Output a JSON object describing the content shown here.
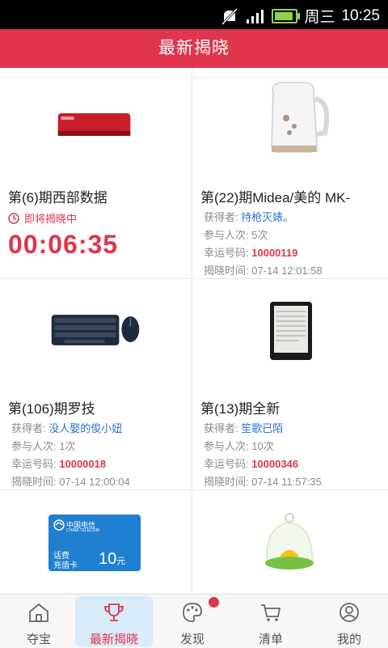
{
  "status_bar": {
    "day": "周三",
    "time": "10:25"
  },
  "header": {
    "title": "最新揭晓"
  },
  "items": [
    {
      "title": "第(6)期西部数据",
      "pending_label": "即将揭晓中",
      "countdown": "00:06:35"
    },
    {
      "title": "第(22)期Midea/美的 MK-",
      "winner_label": "获得者:",
      "winner": "持枪灭婊。",
      "participants_label": "参与人次:",
      "participants": "5次",
      "lucky_label": "幸运号码:",
      "lucky": "10000119",
      "time_label": "揭晓时间:",
      "time": "07-14 12:01:58"
    },
    {
      "title": "第(106)期罗技",
      "winner_label": "获得者:",
      "winner": "没人娶的俊小妞",
      "participants_label": "参与人次:",
      "participants": "1次",
      "lucky_label": "幸运号码:",
      "lucky": "10000018",
      "time_label": "揭晓时间:",
      "time": "07-14 12:00:04"
    },
    {
      "title": "第(13)期全新",
      "winner_label": "获得者:",
      "winner": "笙歌已陌",
      "participants_label": "参与人次:",
      "participants": "10次",
      "lucky_label": "幸运号码:",
      "lucky": "10000346",
      "time_label": "揭晓时间:",
      "time": "07-14 11:57:35"
    },
    {
      "card_brand": "中国电信",
      "card_brand_en": "CHINA TELECOM",
      "card_label_1": "话费",
      "card_label_2": "充值卡",
      "card_value": "10",
      "card_unit": "元"
    },
    {}
  ],
  "tabs": [
    {
      "label": "夺宝",
      "icon": "home-icon"
    },
    {
      "label": "最新揭晓",
      "icon": "trophy-icon",
      "active": true
    },
    {
      "label": "发现",
      "icon": "palette-icon"
    },
    {
      "label": "清单",
      "icon": "cart-icon"
    },
    {
      "label": "我的",
      "icon": "user-icon"
    }
  ],
  "colors": {
    "accent": "#e0354c",
    "link": "#2a6fd6",
    "active_tab_bg": "#d9ebf8"
  }
}
